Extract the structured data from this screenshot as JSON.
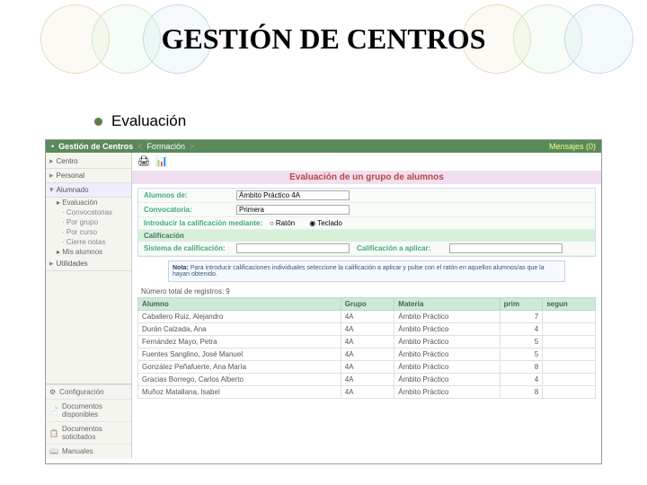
{
  "slide": {
    "title": "GESTIÓN DE CENTROS",
    "subtitle": "Evaluación"
  },
  "topbar": {
    "breadcrumb": [
      "Gestión de Centros",
      "Formación"
    ],
    "messages": "Mensajes (0)"
  },
  "sidebar": {
    "items": [
      {
        "label": "Centro"
      },
      {
        "label": "Personal"
      },
      {
        "label": "Alumnado",
        "expanded": true,
        "children": [
          {
            "label": "Evaluación",
            "children": [
              {
                "label": "Convocatorias"
              },
              {
                "label": "Por grupo",
                "selected": true
              },
              {
                "label": "Por curso"
              },
              {
                "label": "Cierre notas"
              }
            ]
          },
          {
            "label": "Mis alumnos"
          }
        ]
      },
      {
        "label": "Utilidades"
      }
    ],
    "bottom": [
      {
        "icon": "⚙",
        "label": "Configuración"
      },
      {
        "icon": "📄",
        "label": "Documentos disponibles"
      },
      {
        "icon": "📋",
        "label": "Documentos solicitados"
      },
      {
        "icon": "📖",
        "label": "Manuales"
      }
    ]
  },
  "content": {
    "pageTitle": "Evaluación de un grupo de alumnos",
    "rows": {
      "alumnosDe": {
        "label": "Alumnos de:",
        "value": "Ámbito Práctico 4A"
      },
      "convocatoria": {
        "label": "Convocatoria:",
        "value": "Primera"
      },
      "introducir": {
        "label": "Introducir la calificación mediante:",
        "opts": [
          "Ratón",
          "Teclado"
        ]
      }
    },
    "sectionHead": "Calificación",
    "califRow": {
      "label1": "Sistema de calificación:",
      "label2": "Calificación a aplicar:"
    },
    "note": {
      "bold": "Nota:",
      "text": " Para introducir calificaciones individuales seleccione la calificación a aplicar y pulse con el ratón en aquellos alumnos/as que la hayan obtenido."
    },
    "countLabel": "Número total de registros: 9",
    "columns": [
      "Alumno",
      "Grupo",
      "Materia",
      "prim",
      "segun"
    ],
    "rowsData": [
      {
        "alumno": "Caballero Ruiz, Alejandro",
        "grupo": "4A",
        "materia": "Ámbito Práctico",
        "prim": "7"
      },
      {
        "alumno": "Durán Calzada, Ana",
        "grupo": "4A",
        "materia": "Ámbito Práctico",
        "prim": "4"
      },
      {
        "alumno": "Fernández Mayo, Petra",
        "grupo": "4A",
        "materia": "Ámbito Práctico",
        "prim": "5"
      },
      {
        "alumno": "Fuentes Sanglino, José Manuel",
        "grupo": "4A",
        "materia": "Ámbito Práctico",
        "prim": "5"
      },
      {
        "alumno": "González Peñafuerte, Ana María",
        "grupo": "4A",
        "materia": "Ámbito Práctico",
        "prim": "8"
      },
      {
        "alumno": "Gracias Borrego, Carlos Alberto",
        "grupo": "4A",
        "materia": "Ámbito Práctico",
        "prim": "4"
      },
      {
        "alumno": "Muñoz Matallana, Isabel",
        "grupo": "4A",
        "materia": "Ámbito Práctico",
        "prim": "8"
      }
    ]
  }
}
